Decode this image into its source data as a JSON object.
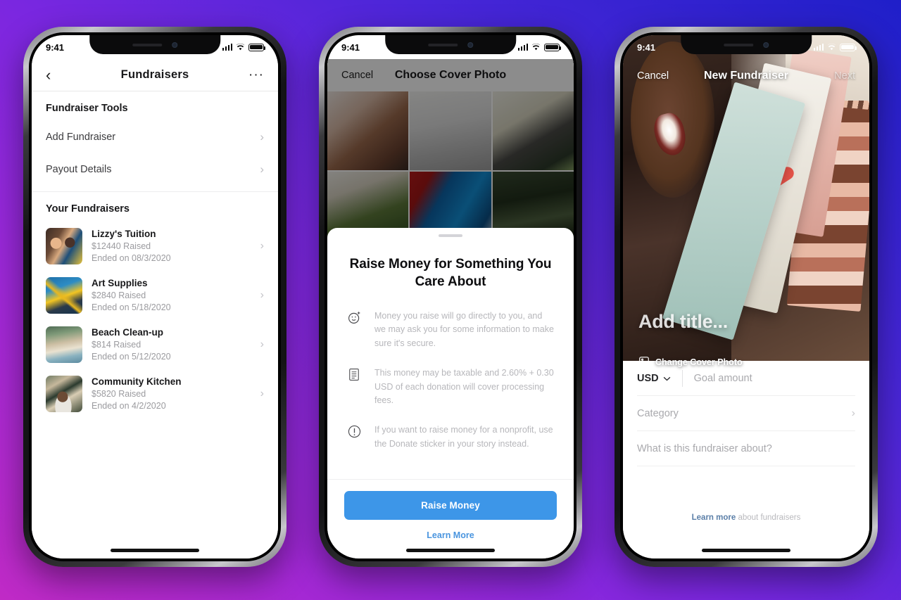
{
  "background": {
    "from": "#c02ac6",
    "to": "#1f1fc9"
  },
  "accent": {
    "blue_button": "#3d96e8",
    "link_blue": "#4a95df"
  },
  "phone1": {
    "status": {
      "time": "9:41"
    },
    "nav": {
      "back_icon": "chevron-left-icon",
      "title": "Fundraisers",
      "more_icon": "more-options-icon",
      "more_label": "···"
    },
    "tools_header": "Fundraiser Tools",
    "tools": [
      {
        "label": "Add Fundraiser"
      },
      {
        "label": "Payout Details"
      }
    ],
    "your_header": "Your Fundraisers",
    "fundraisers": [
      {
        "title": "Lizzy's Tuition",
        "raised": "$12440 Raised",
        "ended": "Ended on 08/3/2020"
      },
      {
        "title": "Art Supplies",
        "raised": "$2840 Raised",
        "ended": "Ended on 5/18/2020"
      },
      {
        "title": "Beach Clean-up",
        "raised": "$814 Raised",
        "ended": "Ended on 5/12/2020"
      },
      {
        "title": "Community Kitchen",
        "raised": "$5820 Raised",
        "ended": "Ended on 4/2/2020"
      }
    ],
    "chevron": "›"
  },
  "phone2": {
    "status": {
      "time": "9:41"
    },
    "nav": {
      "cancel": "Cancel",
      "title": "Choose Cover Photo"
    },
    "sheet": {
      "title": "Raise Money for Something You Care About",
      "items": [
        {
          "icon": "smiley-sparkle-icon",
          "text": "Money you raise will go directly to you, and we may ask you for some information to make sure it's secure."
        },
        {
          "icon": "document-icon",
          "text": "This money may be taxable and 2.60% + 0.30 USD of each donation will cover processing fees."
        },
        {
          "icon": "exclamation-circle-icon",
          "text": "If you want to raise money for a nonprofit, use the Donate sticker in your story instead."
        }
      ],
      "primary_button": "Raise Money",
      "learn_more": "Learn More"
    }
  },
  "phone3": {
    "status": {
      "time": "9:41"
    },
    "nav": {
      "cancel": "Cancel",
      "title": "New Fundraiser",
      "next": "Next"
    },
    "cover": {
      "add_title": "Add title...",
      "change_cover": "Change Cover Photo",
      "change_cover_icon": "photo-icon"
    },
    "form": {
      "currency": "USD",
      "currency_chevron_icon": "chevron-down-icon",
      "goal_placeholder": "Goal amount",
      "category_label": "Category",
      "about_placeholder": "What is this fundraiser about?"
    },
    "footer": {
      "link": "Learn more",
      "rest": " about fundraisers"
    }
  }
}
